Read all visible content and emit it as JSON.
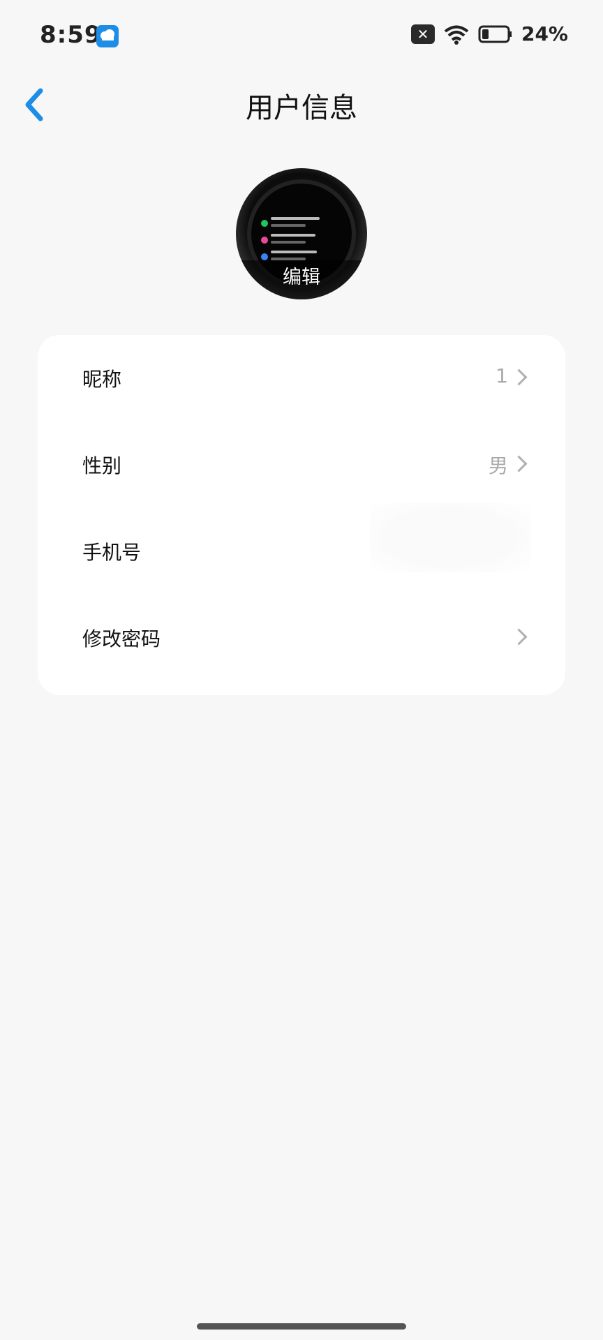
{
  "status_bar": {
    "time": "8:59",
    "battery_percent": "24%",
    "icons": [
      "weather-app-icon",
      "sim-disabled-icon",
      "wifi-icon",
      "battery-icon"
    ]
  },
  "header": {
    "back_icon": "chevron-left-icon",
    "title": "用户信息"
  },
  "avatar": {
    "edit_label": "编辑"
  },
  "settings": {
    "rows": [
      {
        "label": "昵称",
        "value": "1"
      },
      {
        "label": "性别",
        "value": "男"
      },
      {
        "label": "手机号",
        "value": "15"
      },
      {
        "label": "修改密码",
        "value": ""
      }
    ]
  },
  "colors": {
    "accent": "#1e8de6",
    "background": "#f7f7f7",
    "card": "#ffffff",
    "muted_text": "#aaaaaa"
  }
}
